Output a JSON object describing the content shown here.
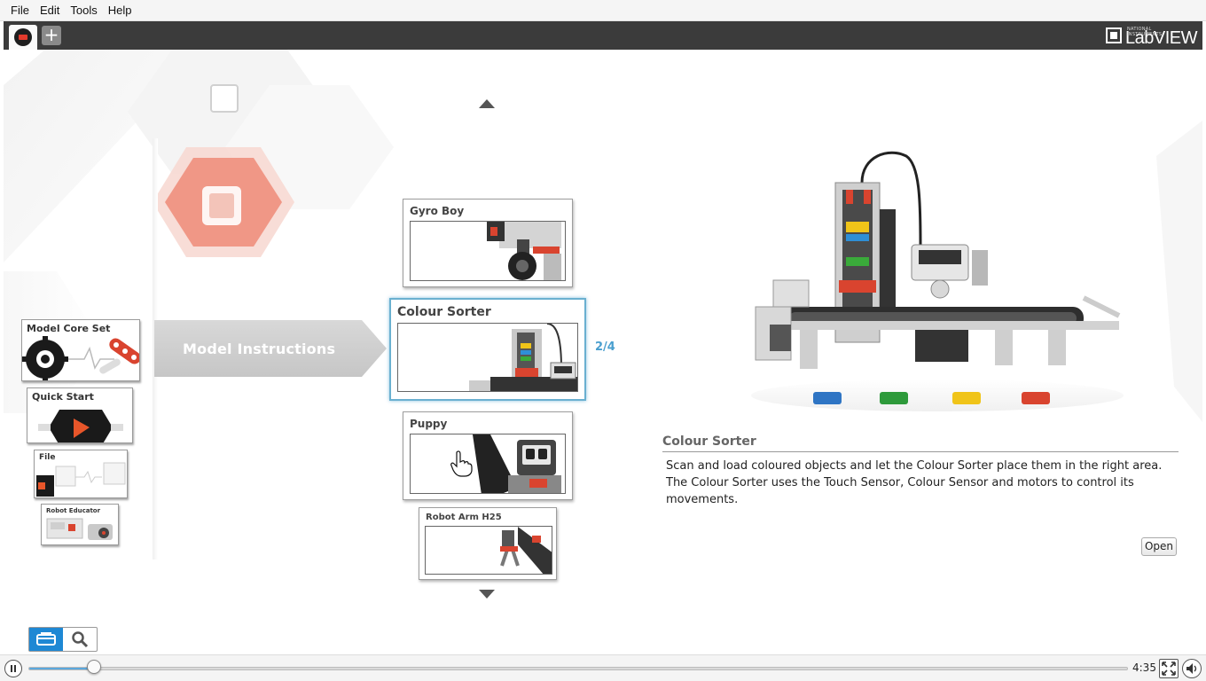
{
  "menu": {
    "items": [
      {
        "label": "File"
      },
      {
        "label": "Edit"
      },
      {
        "label": "Tools"
      },
      {
        "label": "Help"
      }
    ]
  },
  "tabs": {
    "home_icon": "lego-mindstorms-home-icon",
    "add_label": "+"
  },
  "brand": {
    "small_text": "NATIONAL INSTRUMENTS",
    "name": "LabVIEW"
  },
  "left_nav": {
    "banner_label": "Model Instructions",
    "items": [
      {
        "label": "Model Core Set"
      },
      {
        "label": "Quick Start"
      },
      {
        "label": "File"
      },
      {
        "label": "Robot Educator"
      }
    ]
  },
  "models": {
    "counter": "2/4",
    "items": [
      {
        "title": "Gyro Boy"
      },
      {
        "title": "Colour Sorter",
        "selected": true
      },
      {
        "title": "Puppy"
      },
      {
        "title": "Robot Arm H25"
      }
    ]
  },
  "detail": {
    "title": "Colour Sorter",
    "paragraphs": [
      "Scan and load coloured objects and let the Colour Sorter place them in the right area.",
      "The Colour Sorter uses the Touch Sensor, Colour Sensor and motors to control its movements."
    ],
    "open_label": "Open"
  },
  "view_toggle": {
    "active": "print-view-icon",
    "icons": [
      "print-view-icon",
      "search-icon"
    ]
  },
  "player": {
    "time": "4:35",
    "progress": 0.06
  },
  "colors": {
    "accent_blue": "#4a9fcf",
    "selection_border": "#6ab0d0",
    "ev3_red": "#e2402f",
    "toggle_active": "#1e88d4"
  }
}
